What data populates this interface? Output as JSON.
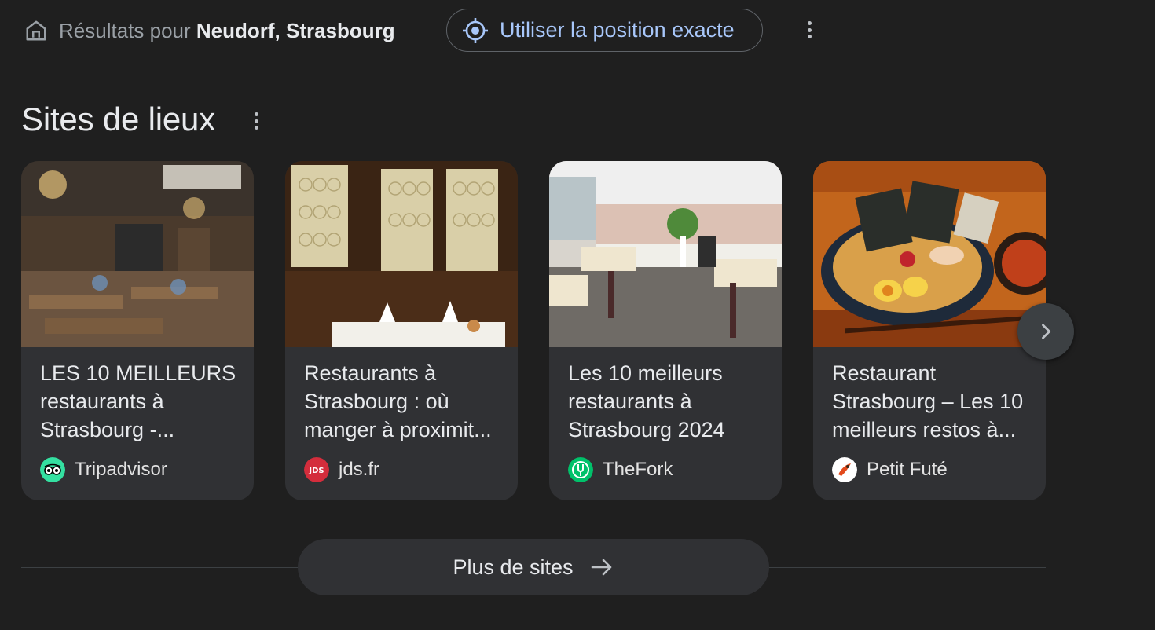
{
  "location": {
    "prefix": "Résultats pour",
    "place": "Neudorf, Strasbourg",
    "exact_button": "Utiliser la position exacte"
  },
  "section": {
    "title": "Sites de lieux"
  },
  "cards": [
    {
      "title": "LES 10 MEILLEURS restaurants à Strasbourg -...",
      "source": "Tripadvisor",
      "favicon_text": ""
    },
    {
      "title": "Restaurants à Strasbourg : où manger à proximit...",
      "source": "jds.fr",
      "favicon_text": "JDS"
    },
    {
      "title": "Les 10 meilleurs restaurants à Strasbourg 2024",
      "source": "TheFork",
      "favicon_text": ""
    },
    {
      "title": "Restaurant Strasbourg – Les 10 meilleurs restos à...",
      "source": "Petit Futé",
      "favicon_text": ""
    }
  ],
  "more": {
    "label": "Plus de sites"
  },
  "colors": {
    "background": "#1f1f1f",
    "card": "#303134",
    "accent": "#a8c7fa",
    "tripadvisor": "#34e0a1",
    "jds": "#d42d3c",
    "thefork": "#00c16a"
  }
}
